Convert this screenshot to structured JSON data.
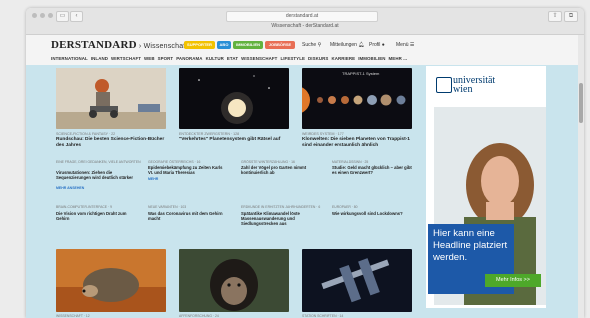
{
  "browser": {
    "url": "derstandard.at",
    "tab_title": "Wissenschaft - derStandard.at"
  },
  "header": {
    "logo": "DERSTANDARD",
    "section": "Wissenschaft",
    "pills": [
      {
        "label": "SUPPORTER",
        "color": "#f2c200"
      },
      {
        "label": "ABO",
        "color": "#2a8fd6"
      },
      {
        "label": "IMMOBILIEN",
        "color": "#62b23f"
      },
      {
        "label": "JOBBÖRSE",
        "color": "#e86e55"
      }
    ],
    "search": "Suche",
    "messages": "Mitteilungen",
    "profile": "Profil",
    "menu": "Menü"
  },
  "nav": [
    "INTERNATIONAL",
    "INLAND",
    "WIRTSCHAFT",
    "WEB",
    "SPORT",
    "PANORAMA",
    "KULTUR",
    "ETAT",
    "WISSENSCHAFT",
    "LIFESTYLE",
    "DISKURS",
    "KARRIERE",
    "IMMOBILIEN",
    "MEHR ..."
  ],
  "cards": [
    {
      "kicker": "SCIENCE-FICTION & FANTASY · 22",
      "title": "Rundschau: Die besten Science-Fiction-Bücher des Jahres"
    },
    {
      "kicker": "ENTDECKTER ZWERGSTERN · 128",
      "title": "\"Verkehrtes\" Planetensystem gibt Rätsel auf"
    },
    {
      "kicker": "WEIRDES SYSTEM · 177",
      "title": "Klonwelten: Die sieben Planeten von Trappist-1 sind einander erstaunlich ähnlich"
    }
  ],
  "image_caption": "TRAPPIST-1 System",
  "small_items": [
    {
      "kicker": "EINE FRAGE, DREI GEDANKEN, VIELE ANTWORTEN",
      "text": "Virusmutationen: Ziehen die Sequenzierungen wird deutlich stärker",
      "extra": "MEHR ANSEHEN"
    },
    {
      "kicker": "GEOGRAFIE ÖSTERREICHS · 16",
      "text": "Epidemiebekämpfung zu Zeiten Karls VI. und Maria Theresias",
      "extra": "MEHR"
    },
    {
      "kicker": "GRÖSSTE WINTERZÄHLUNG · 16",
      "text": "Zahl der Vögel pro Garten nimmt kontinuierlich ab",
      "extra": ""
    },
    {
      "kicker": "MATERIALDSSINN · 25",
      "text": "Studie: Geld macht glücklich – aber gibt es einen Grenzwert?",
      "extra": ""
    },
    {
      "kicker": "BRAIN-COMPUTER-INTERFACE · 9",
      "text": "Die Vision vom richtigen Draht zum Gehirn",
      "extra": ""
    },
    {
      "kicker": "NEUE VARIANTEN · 103",
      "text": "Was das Coronavirus mit dem Gehirn macht",
      "extra": ""
    },
    {
      "kicker": "ERDKUNDE IN ERHITZTEN JAHRHUNDERTEN · 6",
      "text": "Spätantike Klimawandel löste Massenauswanderung und Siedlungsstrecken aus",
      "extra": ""
    },
    {
      "kicker": "EUROPAER · 80",
      "text": "Wie wirkungsvoll sind Lockdowns?",
      "extra": ""
    }
  ],
  "bottom_kickers": [
    "WISSENSCHAFT · 12",
    "AFFENFORSCHUNG · 24",
    "STATION SCHRIFTEN · 14"
  ],
  "ad": {
    "logo_line1": "universität",
    "logo_line2": "wien",
    "headline": "Hier kann eine Headline platziert werden.",
    "button": "Mehr Infos >>"
  }
}
